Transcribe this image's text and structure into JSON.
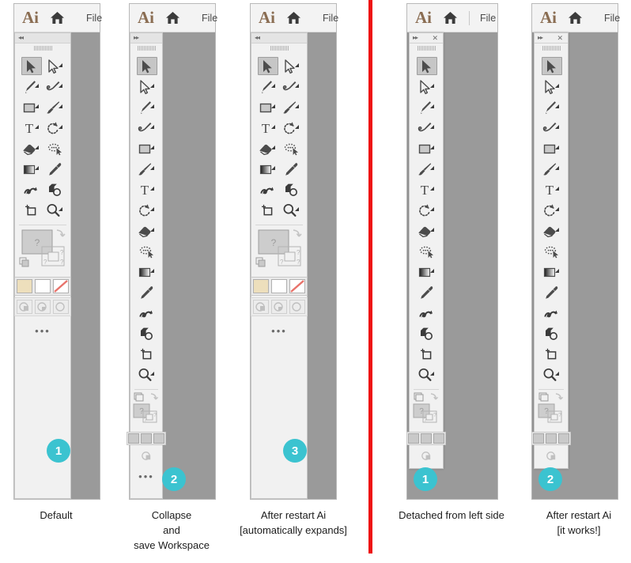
{
  "figure": {
    "title": "Adobe Illustrator toolbar collapse behaviour comparison",
    "accent_color": "#3bc3d0",
    "divider_color": "#ee1111",
    "canvas_color": "#9a9a9a",
    "panel_color": "#f1f1f1"
  },
  "app_header": {
    "logo_text": "Ai",
    "home_icon": "home-icon",
    "menu_label": "File"
  },
  "toolbar": {
    "collapse_chevron": "◂◂",
    "expand_chevron": "▸▸",
    "close_label": "✕",
    "grip": "drag-grip",
    "overflow_label": "•••",
    "tools": [
      {
        "id": "selection-tool",
        "name": "Selection Tool",
        "icon": "arrow-cursor-icon",
        "selected": true,
        "has_flyout": false
      },
      {
        "id": "direct-selection-tool",
        "name": "Direct Selection Tool",
        "icon": "hollow-arrow-cursor-icon",
        "selected": false,
        "has_flyout": true
      },
      {
        "id": "pen-tool",
        "name": "Pen Tool",
        "icon": "pen-nib-icon",
        "selected": false,
        "has_flyout": true
      },
      {
        "id": "curvature-tool",
        "name": "Curvature Tool",
        "icon": "curvature-pen-icon",
        "selected": false,
        "has_flyout": true
      },
      {
        "id": "rectangle-tool",
        "name": "Rectangle Tool",
        "icon": "rectangle-icon",
        "selected": false,
        "has_flyout": true
      },
      {
        "id": "paintbrush-tool",
        "name": "Paintbrush Tool",
        "icon": "paintbrush-icon",
        "selected": false,
        "has_flyout": true
      },
      {
        "id": "type-tool",
        "name": "Type Tool",
        "icon": "letter-t-icon",
        "selected": false,
        "has_flyout": true
      },
      {
        "id": "rotate-tool",
        "name": "Rotate Tool",
        "icon": "rotate-arrow-icon",
        "selected": false,
        "has_flyout": true
      },
      {
        "id": "eraser-tool",
        "name": "Eraser Tool",
        "icon": "eraser-icon",
        "selected": false,
        "has_flyout": true
      },
      {
        "id": "lasso-tool",
        "name": "Lasso Tool",
        "icon": "lasso-cursor-icon",
        "selected": false,
        "has_flyout": false
      },
      {
        "id": "gradient-tool",
        "name": "Gradient Tool",
        "icon": "gradient-swatch-icon",
        "selected": false,
        "has_flyout": true
      },
      {
        "id": "eyedropper-tool",
        "name": "Eyedropper Tool",
        "icon": "eyedropper-icon",
        "selected": false,
        "has_flyout": false
      },
      {
        "id": "blend-tool",
        "name": "Blend Tool",
        "icon": "blend-squiggle-icon",
        "selected": false,
        "has_flyout": false
      },
      {
        "id": "shape-builder-tool",
        "name": "Shape Builder Tool",
        "icon": "shape-builder-icon",
        "selected": false,
        "has_flyout": false
      },
      {
        "id": "artboard-tool",
        "name": "Artboard Tool",
        "icon": "artboard-crop-icon",
        "selected": false,
        "has_flyout": false
      },
      {
        "id": "zoom-tool",
        "name": "Zoom Tool",
        "icon": "magnifier-icon",
        "selected": false,
        "has_flyout": true
      }
    ],
    "controls": {
      "swap_fill_stroke": "swap-arrow-icon",
      "default_fill_stroke": "default-fill-stroke-icon",
      "fill_swatch": "fill-swatch",
      "stroke_swatch": "stroke-swatch",
      "fill_placeholder": "?",
      "stroke_placeholder": "?",
      "color_mode_color": "color-swatch-button",
      "color_mode_gradient": "gradient-swatch-button",
      "color_mode_none": "none-swatch-button",
      "screen_mode_normal": "normal-screen-mode-button",
      "screen_mode_full_menu": "full-screen-with-menu-button",
      "screen_mode_full": "full-screen-button",
      "fill_color_hex": "#eddfbc",
      "stroke_color_hex": "#ffffff",
      "none_color_hex": "#e8736b"
    }
  },
  "panels": [
    {
      "id": "panel-1",
      "badge": "1",
      "chevron": "collapse",
      "columns": 2,
      "detached": false,
      "caption": [
        "Default"
      ]
    },
    {
      "id": "panel-2",
      "badge": "2",
      "chevron": "expand",
      "columns": 1,
      "detached": false,
      "caption": [
        "Collapse",
        "and",
        "save Workspace"
      ]
    },
    {
      "id": "panel-3",
      "badge": "3",
      "chevron": "collapse",
      "columns": 2,
      "detached": false,
      "caption": [
        "After restart Ai",
        "[automatically expands]"
      ]
    },
    {
      "id": "panel-4",
      "badge": "1",
      "chevron": "expand",
      "columns": 1,
      "detached": true,
      "caption": [
        "Detached from left side"
      ]
    },
    {
      "id": "panel-5",
      "badge": "2",
      "chevron": "expand",
      "columns": 1,
      "detached": true,
      "caption": [
        "After restart Ai",
        "[it works!]"
      ]
    }
  ]
}
